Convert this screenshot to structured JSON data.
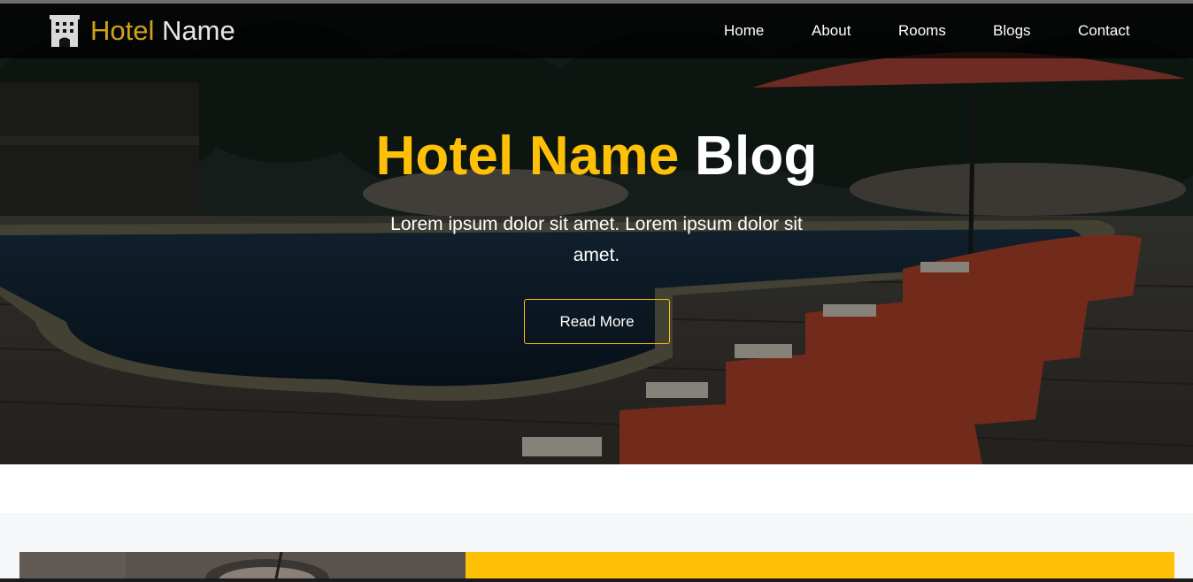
{
  "brand": {
    "accent_text": "Hotel",
    "rest_text": " Name",
    "icon": "hotel-building-icon"
  },
  "nav": {
    "items": [
      "Home",
      "About",
      "Rooms",
      "Blogs",
      "Contact"
    ]
  },
  "hero": {
    "title_accent": "Hotel Name",
    "title_rest": " Blog",
    "subtitle": "Lorem ipsum dolor sit amet. Lorem ipsum dolor sit amet.",
    "button_label": "Read More"
  },
  "colors": {
    "accent": "#ffc107",
    "brand_accent": "#d2a11a",
    "nav_bg": "#000000",
    "section_bg": "#f5f7f9"
  }
}
